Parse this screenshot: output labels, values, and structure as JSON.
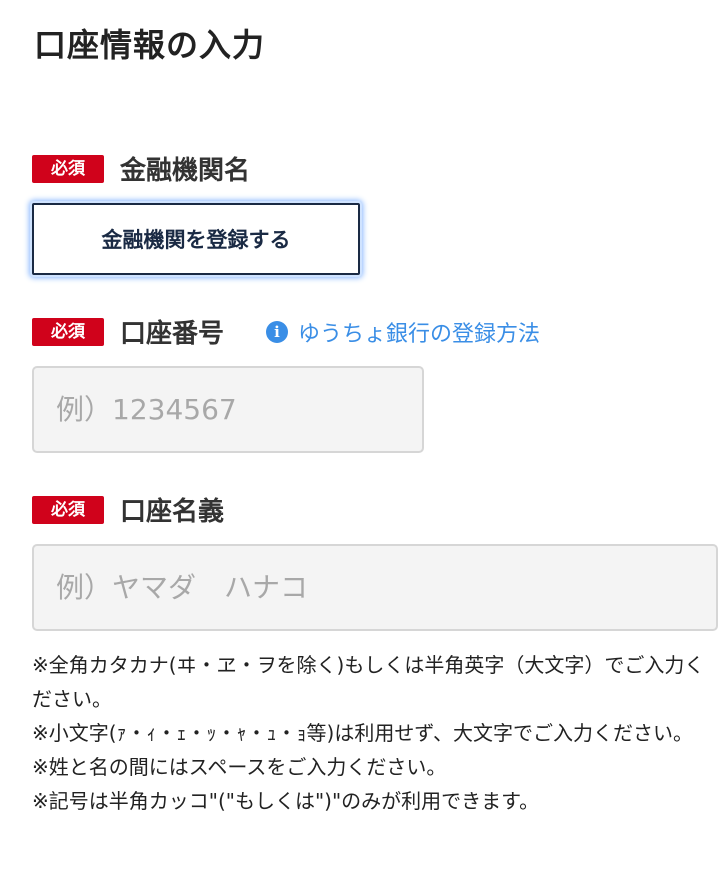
{
  "page": {
    "title": "口座情報の入力"
  },
  "badges": {
    "required": "必須"
  },
  "institution": {
    "label": "金融機関名",
    "button_label": "金融機関を登録する"
  },
  "account_number": {
    "label": "口座番号",
    "help_link": "ゆうちょ銀行の登録方法",
    "help_icon": "info-icon",
    "placeholder": "例）1234567",
    "value": ""
  },
  "account_holder": {
    "label": "口座名義",
    "placeholder": "例）ヤマダ　ハナコ",
    "value": ""
  },
  "notes": [
    "※全角カタカナ(ヰ・ヱ・ヲを除く)もしくは半角英字（大文字）でご入力ください。",
    "※小文字(ｧ・ｨ・ｪ・ｯ・ｬ・ｭ・ｮ等)は利用せず、大文字でご入力ください。",
    "※姓と名の間にはスペースをご入力ください。",
    "※記号は半角カッコ\"(\"もしくは\")\"のみが利用できます。"
  ],
  "colors": {
    "required_badge": "#d0021b",
    "link": "#3a8ee6",
    "button_border": "#1a2a44",
    "input_background": "#f4f4f4"
  }
}
